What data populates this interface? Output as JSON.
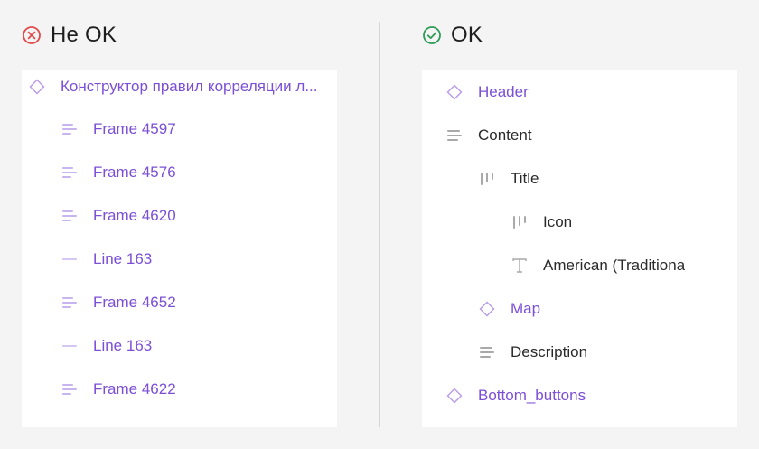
{
  "bad": {
    "title": "Не OK",
    "header_icon": "error-circle-x-icon",
    "items": [
      {
        "label": "Конструктор правил корреляции л...",
        "icon": "component-diamond-icon"
      },
      {
        "label": "Frame 4597",
        "icon": "auto-layout-horizontal-icon"
      },
      {
        "label": "Frame 4576",
        "icon": "auto-layout-horizontal-icon"
      },
      {
        "label": "Frame 4620",
        "icon": "auto-layout-horizontal-icon"
      },
      {
        "label": "Line 163",
        "icon": "line-icon"
      },
      {
        "label": "Frame 4652",
        "icon": "auto-layout-horizontal-icon"
      },
      {
        "label": "Line 163",
        "icon": "line-icon"
      },
      {
        "label": "Frame 4622",
        "icon": "auto-layout-horizontal-icon"
      }
    ]
  },
  "good": {
    "title": "OK",
    "header_icon": "success-circle-check-icon",
    "items": [
      {
        "label": "Header",
        "icon": "component-diamond-icon"
      },
      {
        "label": "Content",
        "icon": "auto-layout-horizontal-icon"
      },
      {
        "label": "Title",
        "icon": "auto-layout-vertical-icon"
      },
      {
        "label": "Icon",
        "icon": "auto-layout-vertical-icon"
      },
      {
        "label": "American (Traditiona",
        "icon": "text-icon"
      },
      {
        "label": "Map",
        "icon": "component-diamond-icon"
      },
      {
        "label": "Description",
        "icon": "auto-layout-horizontal-icon"
      },
      {
        "label": "Bottom_buttons",
        "icon": "component-diamond-icon"
      }
    ]
  },
  "colors": {
    "background": "#f4f4f4",
    "panel": "#ffffff",
    "component": "#7b4fd6",
    "component_icon": "#b79be8",
    "frame_icon": "#a9a9a9",
    "text_dark": "#2a2a2a",
    "error": "#e24b4b",
    "success": "#2e9b57"
  }
}
